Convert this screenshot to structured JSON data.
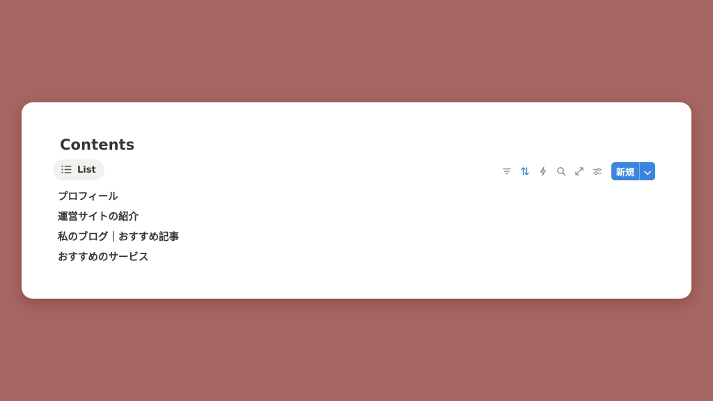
{
  "page": {
    "background_color": "#a76561",
    "accent_color": "#3a85dd"
  },
  "database": {
    "title": "Contents",
    "view_tab": {
      "icon": "list-icon",
      "label": "List"
    },
    "toolbar": {
      "icons": [
        "filter-icon",
        "sort-icon",
        "automation-icon",
        "search-icon",
        "expand-icon",
        "settings-icon"
      ],
      "new_button_label": "新規"
    },
    "items": [
      "プロフィール",
      "運営サイトの紹介",
      "私のブログ｜おすすめ記事",
      "おすすめのサービス"
    ]
  }
}
